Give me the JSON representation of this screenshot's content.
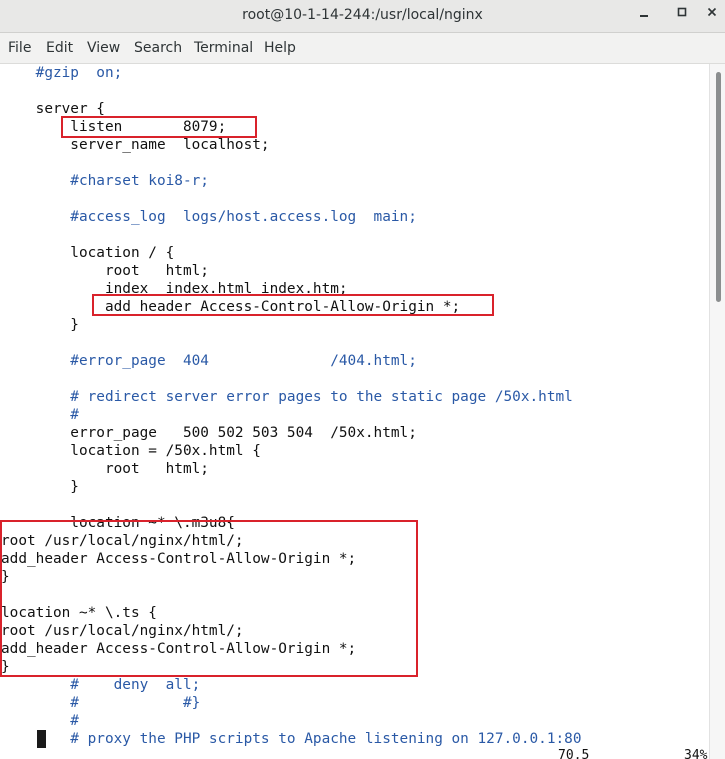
{
  "window": {
    "title": "root@10-1-14-244:/usr/local/nginx",
    "minimize_icon": "minimize-icon",
    "maximize_icon": "maximize-icon",
    "close_icon": "close-icon"
  },
  "menu": [
    "File",
    "Edit",
    "View",
    "Search",
    "Terminal",
    "Help"
  ],
  "terminal": {
    "lines": [
      {
        "text": "    #gzip  on;",
        "comment": true
      },
      {
        "text": "",
        "comment": false
      },
      {
        "text": "    server {",
        "comment": false
      },
      {
        "text": "        listen       8079;",
        "comment": false
      },
      {
        "text": "        server_name  localhost;",
        "comment": false
      },
      {
        "text": "",
        "comment": false
      },
      {
        "text": "        #charset koi8-r;",
        "comment": true
      },
      {
        "text": "",
        "comment": false
      },
      {
        "text": "        #access_log  logs/host.access.log  main;",
        "comment": true
      },
      {
        "text": "",
        "comment": false
      },
      {
        "text": "        location / {",
        "comment": false
      },
      {
        "text": "            root   html;",
        "comment": false
      },
      {
        "text": "            index  index.html index.htm;",
        "comment": false
      },
      {
        "text": "            add_header Access-Control-Allow-Origin *;",
        "comment": false
      },
      {
        "text": "        }",
        "comment": false
      },
      {
        "text": "",
        "comment": false
      },
      {
        "text": "        #error_page  404              /404.html;",
        "comment": true
      },
      {
        "text": "",
        "comment": false
      },
      {
        "text": "        # redirect server error pages to the static page /50x.html",
        "comment": true
      },
      {
        "text": "        #",
        "comment": true
      },
      {
        "text": "        error_page   500 502 503 504  /50x.html;",
        "comment": false
      },
      {
        "text": "        location = /50x.html {",
        "comment": false
      },
      {
        "text": "            root   html;",
        "comment": false
      },
      {
        "text": "        }",
        "comment": false
      },
      {
        "text": "",
        "comment": false
      },
      {
        "text": "        location ~* \\.m3u8{",
        "comment": false
      },
      {
        "text": "root /usr/local/nginx/html/;",
        "comment": false
      },
      {
        "text": "add_header Access-Control-Allow-Origin *;",
        "comment": false
      },
      {
        "text": "}",
        "comment": false
      },
      {
        "text": "",
        "comment": false
      },
      {
        "text": "location ~* \\.ts {",
        "comment": false
      },
      {
        "text": "root /usr/local/nginx/html/;",
        "comment": false
      },
      {
        "text": "add_header Access-Control-Allow-Origin *;",
        "comment": false
      },
      {
        "text": "}",
        "comment": false
      },
      {
        "text": "        #    deny  all;",
        "comment": true
      },
      {
        "text": "        #            #}",
        "comment": true
      },
      {
        "text": "        #",
        "comment": true
      },
      {
        "text": "        # proxy the PHP scripts to Apache listening on 127.0.0.1:80",
        "comment": true
      }
    ],
    "status_position": "70,5",
    "status_percent": "34%"
  }
}
